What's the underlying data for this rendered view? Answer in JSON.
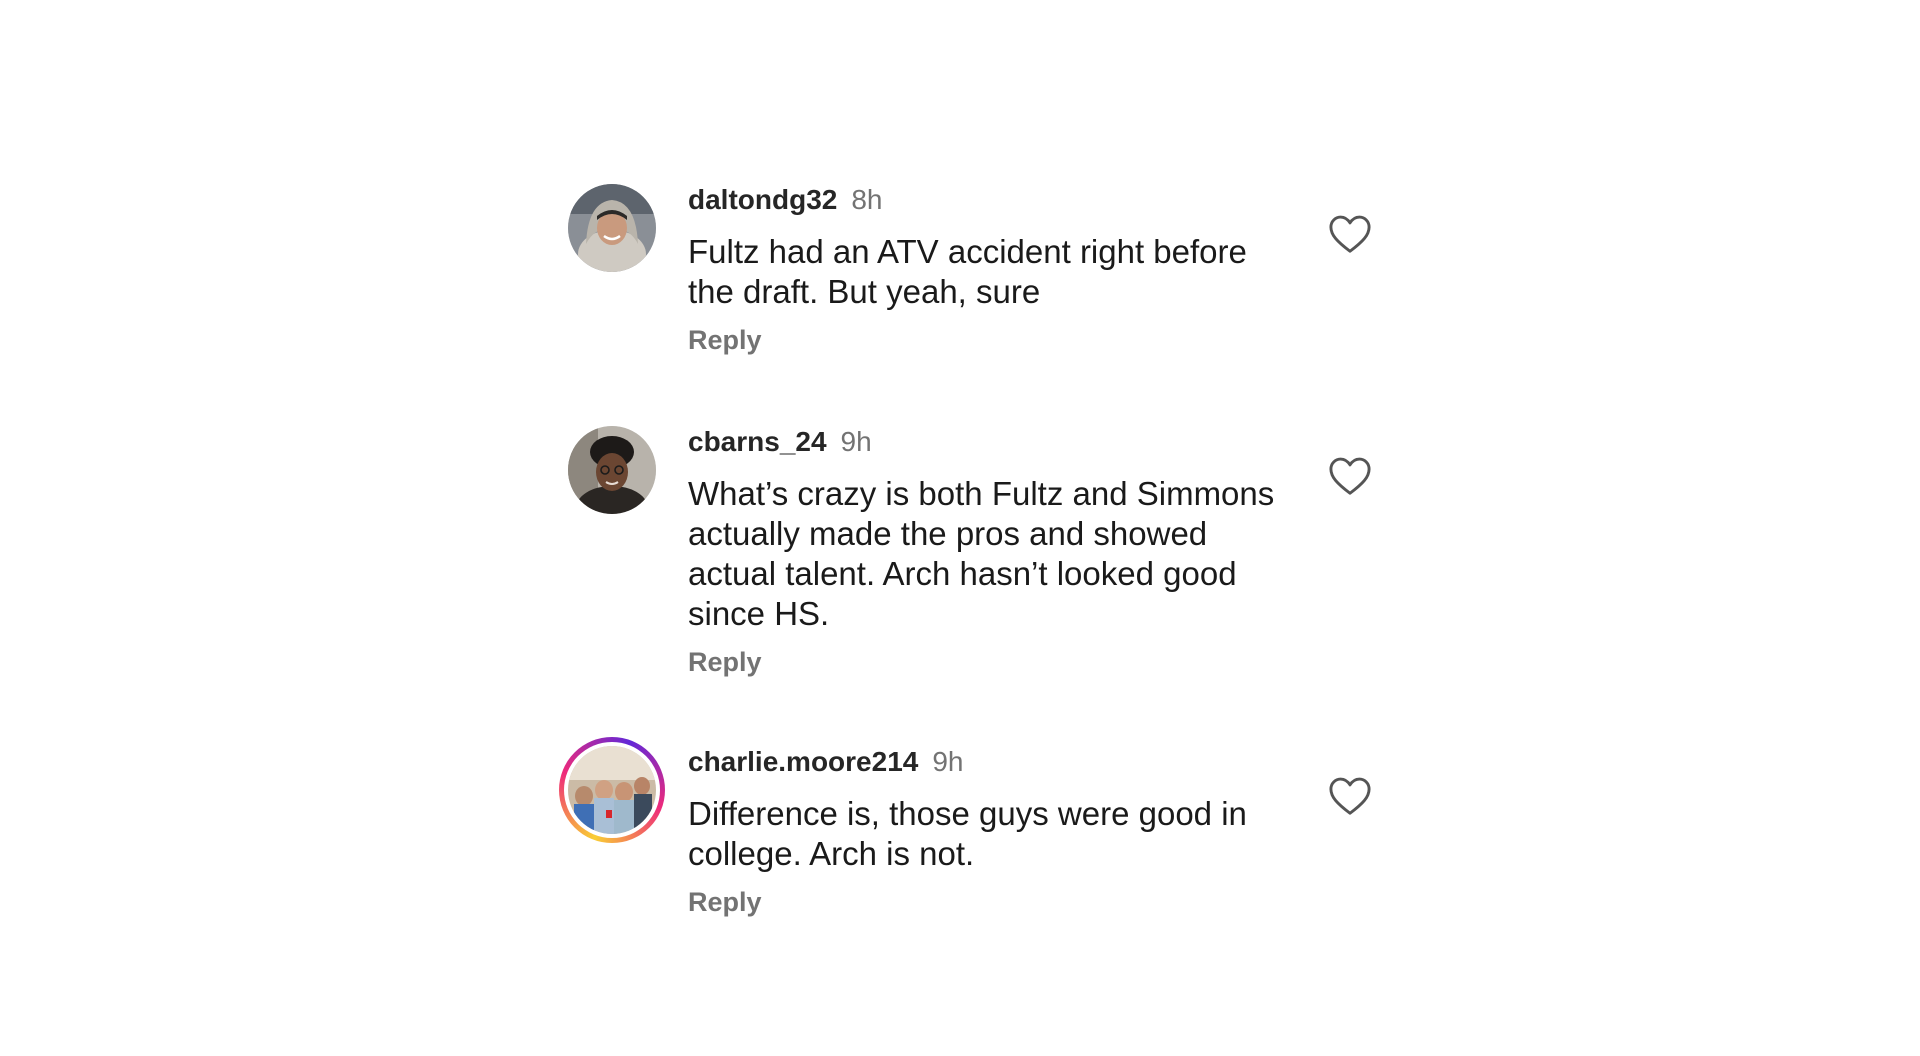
{
  "comments": [
    {
      "username": "daltondg32",
      "time": "8h",
      "text": "Fultz had an ATV accident right before the draft. But yeah, sure",
      "reply_label": "Reply",
      "like_icon": "heart-outline-icon",
      "avatar_story_ring": false
    },
    {
      "username": "cbarns_24",
      "time": "9h",
      "text": "What’s crazy is both Fultz and Simmons actually made the pros and showed actual talent. Arch hasn’t looked good since HS.",
      "reply_label": "Reply",
      "like_icon": "heart-outline-icon",
      "avatar_story_ring": false
    },
    {
      "username": "charlie.moore214",
      "time": "9h",
      "text": "Difference is, those guys were good in college. Arch is not.",
      "reply_label": "Reply",
      "like_icon": "heart-outline-icon",
      "avatar_story_ring": true
    }
  ],
  "colors": {
    "text": "#262626",
    "secondary": "#737373",
    "story_ring": [
      "#f9ce34",
      "#ee2a7b",
      "#6228d7"
    ]
  }
}
